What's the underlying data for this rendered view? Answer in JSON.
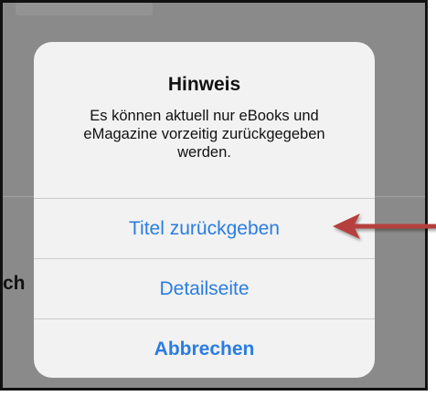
{
  "alert": {
    "title": "Hinweis",
    "message": "Es können aktuell nur eBooks und eMagazine vorzeitig zurückgegeben werden.",
    "actions": [
      {
        "label": "Titel zurückgeben",
        "style": "default"
      },
      {
        "label": "Detailseite",
        "style": "default"
      },
      {
        "label": "Abbrechen",
        "style": "cancel"
      }
    ]
  },
  "background": {
    "partial_text": "ch"
  },
  "colors": {
    "action_blue": "#2a7de1",
    "overlay_gray": "#8a8a8a",
    "annotation_red": "#b5403d"
  },
  "annotation": {
    "icon": "red-arrow-pointing-left"
  }
}
